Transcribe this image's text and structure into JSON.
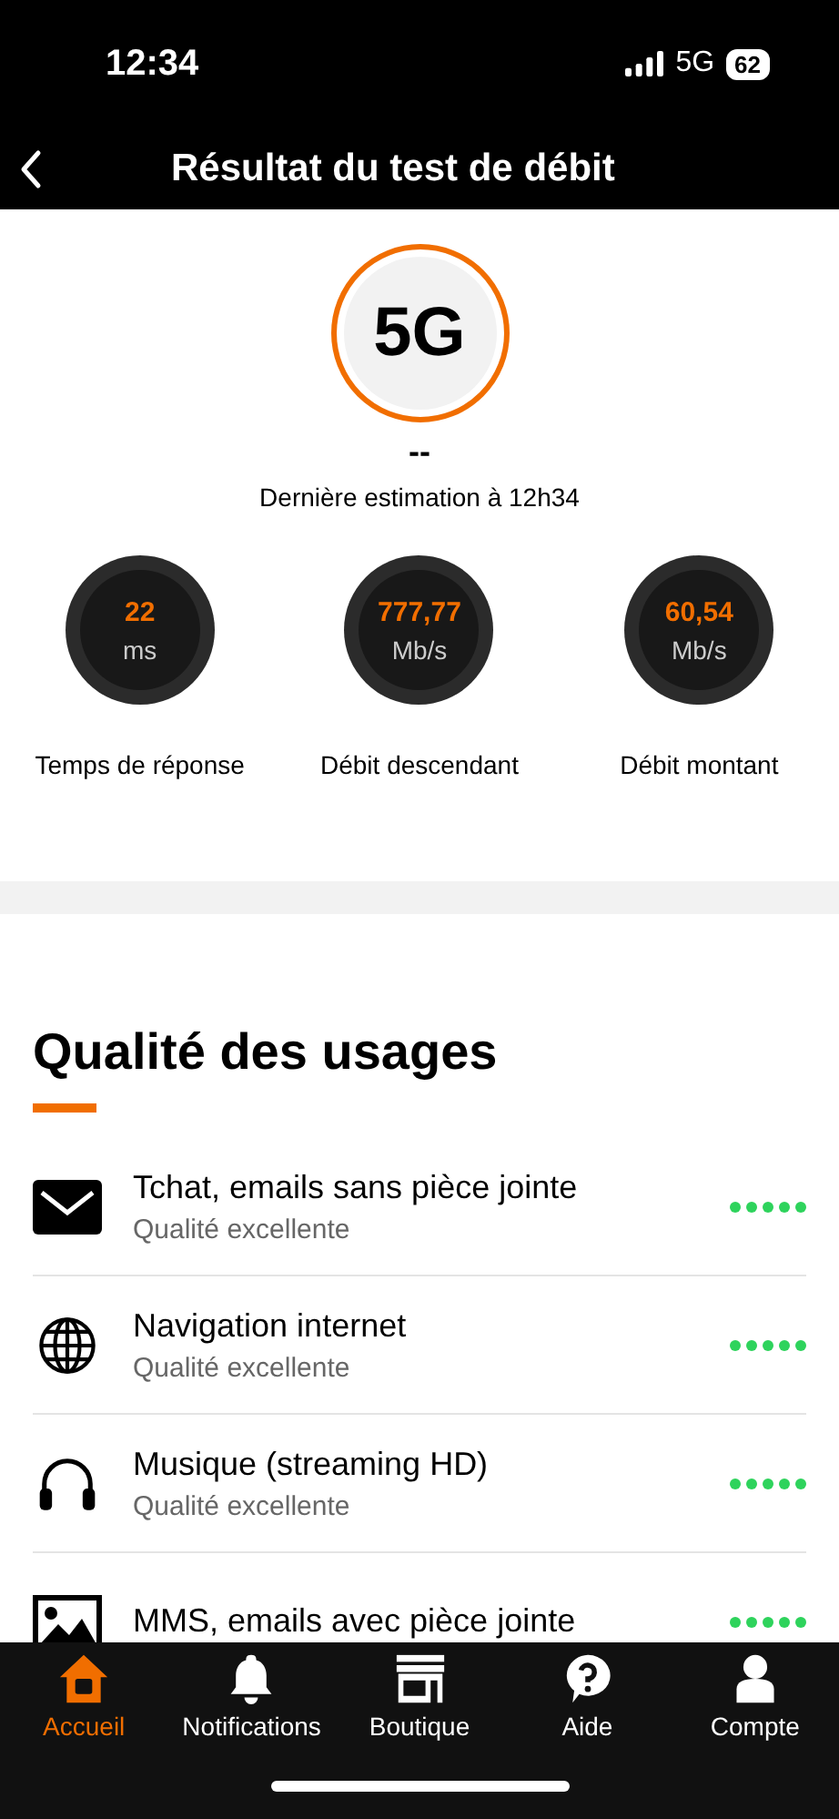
{
  "status_bar": {
    "time": "12:34",
    "network": "5G",
    "battery": "62"
  },
  "header": {
    "title": "Résultat du test de débit"
  },
  "network_badge": {
    "label": "5G",
    "value": "--",
    "estimation": "Dernière estimation à 12h34"
  },
  "gauges": [
    {
      "value": "22",
      "unit": "ms",
      "label": "Temps de réponse"
    },
    {
      "value": "777,77",
      "unit": "Mb/s",
      "label": "Débit descendant"
    },
    {
      "value": "60,54",
      "unit": "Mb/s",
      "label": "Débit montant"
    }
  ],
  "usages": {
    "title": "Qualité des usages",
    "items": [
      {
        "kind": "mail",
        "title": "Tchat, emails sans pièce jointe",
        "subtitle": "Qualité excellente",
        "stars": 5
      },
      {
        "kind": "globe",
        "title": "Navigation internet",
        "subtitle": "Qualité excellente",
        "stars": 5
      },
      {
        "kind": "headphones",
        "title": "Musique (streaming HD)",
        "subtitle": "Qualité excellente",
        "stars": 5
      },
      {
        "kind": "image",
        "title": "MMS, emails avec pièce jointe",
        "stars": 5
      }
    ]
  },
  "tab_bar": [
    {
      "kind": "home",
      "label": "Accueil",
      "selected": true
    },
    {
      "kind": "bell",
      "label": "Notifications",
      "selected": false
    },
    {
      "kind": "shop",
      "label": "Boutique",
      "selected": false
    },
    {
      "kind": "help",
      "label": "Aide",
      "selected": false
    },
    {
      "kind": "account",
      "label": "Compte",
      "selected": false
    }
  ]
}
